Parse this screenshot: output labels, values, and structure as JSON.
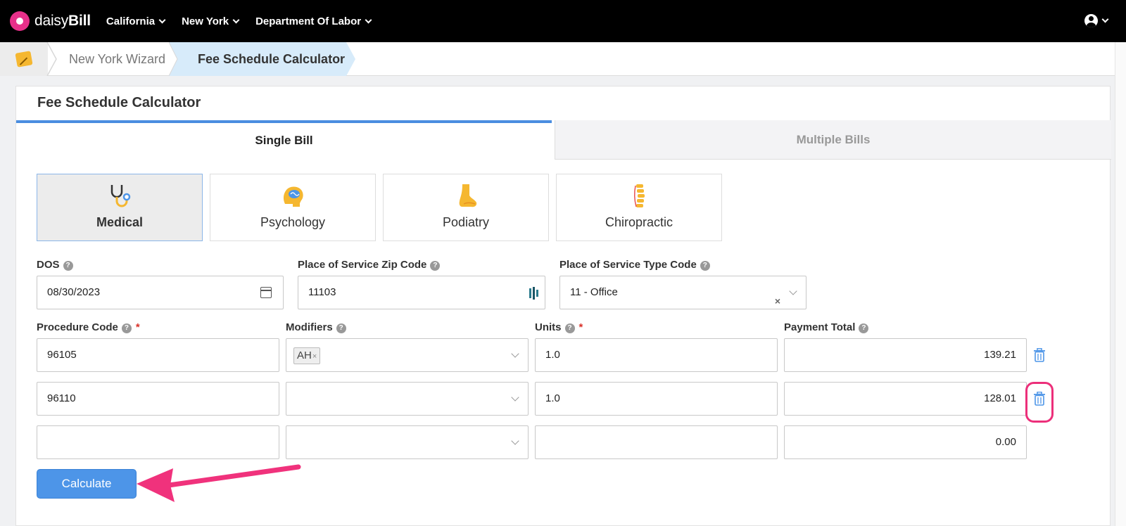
{
  "nav": {
    "brand_light": "daisy",
    "brand_bold": "Bill",
    "menus": [
      "California",
      "New York",
      "Department Of Labor"
    ]
  },
  "breadcrumb": {
    "items": [
      "New York Wizard",
      "Fee Schedule Calculator"
    ]
  },
  "card": {
    "title": "Fee Schedule Calculator",
    "tabs": [
      "Single Bill",
      "Multiple Bills"
    ],
    "active_tab": "Single Bill"
  },
  "specialties": {
    "active": "Medical",
    "items": [
      {
        "label": "Medical",
        "icon": "stethoscope-icon"
      },
      {
        "label": "Psychology",
        "icon": "brain-head-icon"
      },
      {
        "label": "Podiatry",
        "icon": "foot-icon"
      },
      {
        "label": "Chiropractic",
        "icon": "spine-icon"
      }
    ]
  },
  "fields": {
    "dos_label": "DOS",
    "dos_value": "08/30/2023",
    "zip_label": "Place of Service Zip Code",
    "zip_value": "11103",
    "pos_type_label": "Place of Service Type Code",
    "pos_type_value": "11 - Office"
  },
  "lines": {
    "headers": {
      "procedure_code": "Procedure Code",
      "modifiers": "Modifiers",
      "units": "Units",
      "payment_total": "Payment Total"
    },
    "rows": [
      {
        "procedure_code": "96105",
        "modifiers": [
          "AH"
        ],
        "units": "1.0",
        "payment_total": "139.21"
      },
      {
        "procedure_code": "96110",
        "modifiers": [],
        "units": "1.0",
        "payment_total": "128.01"
      },
      {
        "procedure_code": "",
        "modifiers": [],
        "units": "",
        "payment_total": "0.00"
      }
    ]
  },
  "calculate_label": "Calculate",
  "colors": {
    "accent": "#4d95e8",
    "brand": "#e8308a",
    "highlight": "#ec2f7a",
    "required": "#d9322a"
  }
}
